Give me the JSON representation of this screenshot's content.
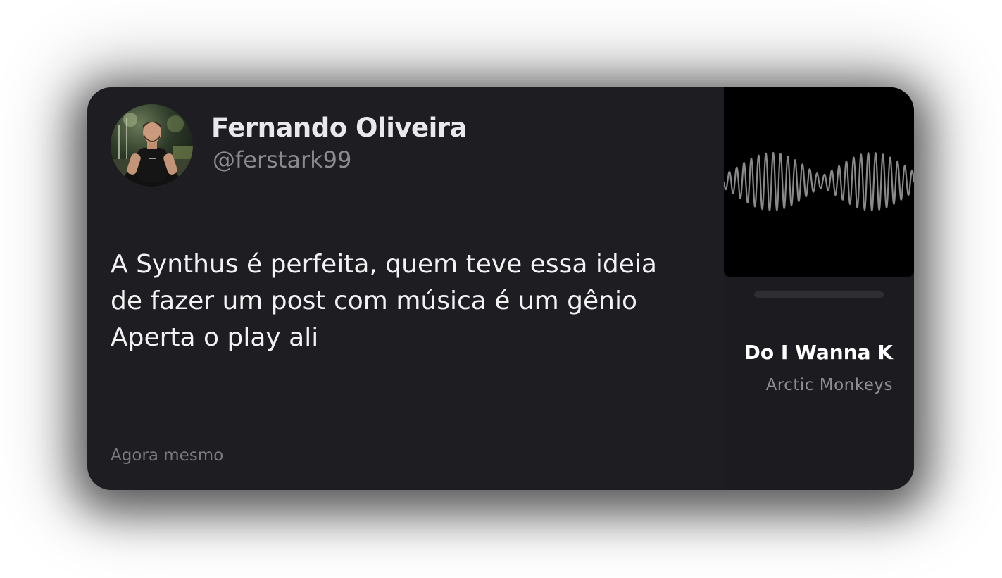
{
  "post": {
    "author_name": "Fernando Oliveira",
    "author_handle": "@ferstark99",
    "text_lines": [
      "A Synthus é perfeita, quem teve essa ideia",
      "de fazer um post com música é um gênio",
      "Aperta o play ali"
    ],
    "timestamp": "Agora mesmo",
    "avatar_icon": "user-avatar-photo"
  },
  "music": {
    "song_title": "Do I Wanna K",
    "artist": "Arctic Monkeys",
    "album_art_icon": "sound-wave-icon",
    "progress": 0
  },
  "colors": {
    "card_background": "#1e1d21",
    "album_background": "#000000",
    "wave_color": "#8a8a8a",
    "text_primary": "#f2f2f4",
    "text_secondary": "#8b8a90"
  }
}
